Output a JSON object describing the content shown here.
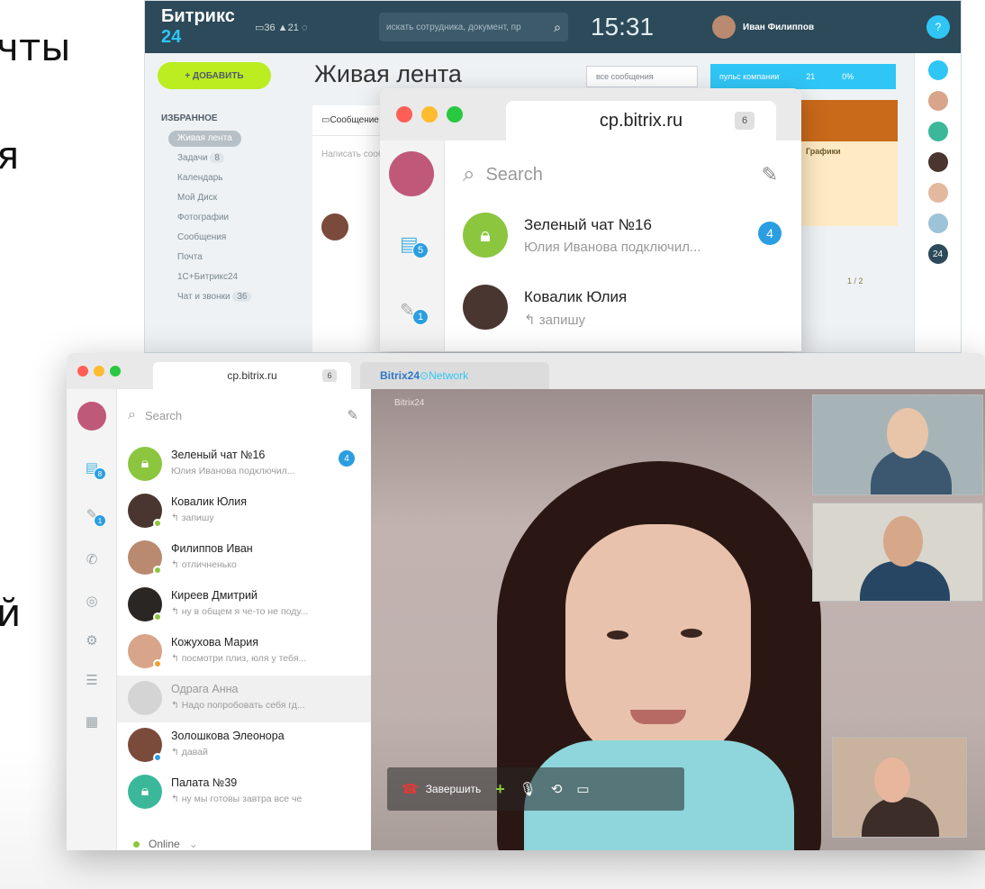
{
  "background_text": [
    "чты",
    "я",
    "й"
  ],
  "portal": {
    "logo_main": "Битрикс",
    "logo_num": "24",
    "counters": "▭36 ▲21 ◌",
    "search_placeholder": "искать сотрудника, документ, пр",
    "time": "15:31",
    "user_name": "Иван Филиппов",
    "help": "?",
    "add_button": "+ ДОБАВИТЬ",
    "nav_favorites": "ИЗБРАННОЕ",
    "nav_items": [
      "Живая лента",
      "Задачи",
      "Календарь",
      "Мой Диск",
      "Фотографии",
      "Сообщения",
      "Почта",
      "1С+Битрикс24",
      "Чат и звонки"
    ],
    "nav_badges": {
      "tasks": "8",
      "chat": "36"
    },
    "page_title": "Живая лента",
    "filter": "все сообщения",
    "company_pulse": "пульс компании",
    "company_pulse_value": "21",
    "company_pulse_pct": "0%",
    "feed_tab": "Сообщение",
    "feed_write": "Написать сообщение",
    "right_badge": "24",
    "sticker": "Графики",
    "pager": "1 / 2"
  },
  "mid_window": {
    "tab_title": "cp.bitrix.ru",
    "tab_count": "6",
    "side_badges": [
      "5",
      "1"
    ],
    "search_placeholder": "Search",
    "chats": [
      {
        "name": "Зеленый чат №16",
        "preview": "Юлия Иванова подключил...",
        "badge": "4",
        "color": "#8cc63f"
      },
      {
        "name": "Ковалик Юлия",
        "preview": "↰ запишу",
        "badge": "",
        "color": "#4a3630"
      }
    ]
  },
  "front_window": {
    "tab_title": "cp.bitrix.ru",
    "tab_count": "6",
    "tab2_title": "Bitrix24",
    "tab2_suffix": "Network",
    "side_badges": [
      "8",
      "1"
    ],
    "search_placeholder": "Search",
    "chats": [
      {
        "name": "Зеленый чат №16",
        "preview": "Юлия Иванова подключил...",
        "badge": "4",
        "color": "#8cc63f"
      },
      {
        "name": "Ковалик Юлия",
        "preview": "↰ запишу",
        "badge": "",
        "color": "#4a3630"
      },
      {
        "name": "Филиппов Иван",
        "preview": "↰ отличненько",
        "badge": "",
        "color": "#b98a6f"
      },
      {
        "name": "Киреев Дмитрий",
        "preview": "↰ ну в общем я че-то не поду...",
        "badge": "",
        "color": "#2a2624"
      },
      {
        "name": "Кожухова Мария",
        "preview": "↰ посмотри плиз, юля у тебя...",
        "badge": "",
        "color": "#d8a48a"
      },
      {
        "name": "Одрага Анна",
        "preview": "↰ Надо попробовать себя гд...",
        "badge": "",
        "color": "#c8c8c8"
      },
      {
        "name": "Золошкова Элеонора",
        "preview": "↰ давай",
        "badge": "",
        "color": "#7a4a3a"
      },
      {
        "name": "Палата №39",
        "preview": "↰ ну мы готовы завтра все че",
        "badge": "",
        "color": "#3bb89a"
      }
    ],
    "online_label": "Online",
    "video_watermark": "Bitrix24",
    "end_call_label": "Завершить"
  },
  "colors": {
    "accent_blue": "#2b9ee1",
    "bitrix_cyan": "#2fc6f6",
    "green": "#8cc63f",
    "portal_header": "#2c4a5a",
    "end_call_red": "#e53935"
  },
  "icons": [
    "search-icon",
    "compose-icon",
    "chat-icon",
    "contacts-icon",
    "phone-icon",
    "camera-icon",
    "settings-icon",
    "notes-icon",
    "doc-icon",
    "lock-icon",
    "end-call-icon",
    "add-participant-icon",
    "microphone-icon",
    "history-icon",
    "message-icon"
  ]
}
